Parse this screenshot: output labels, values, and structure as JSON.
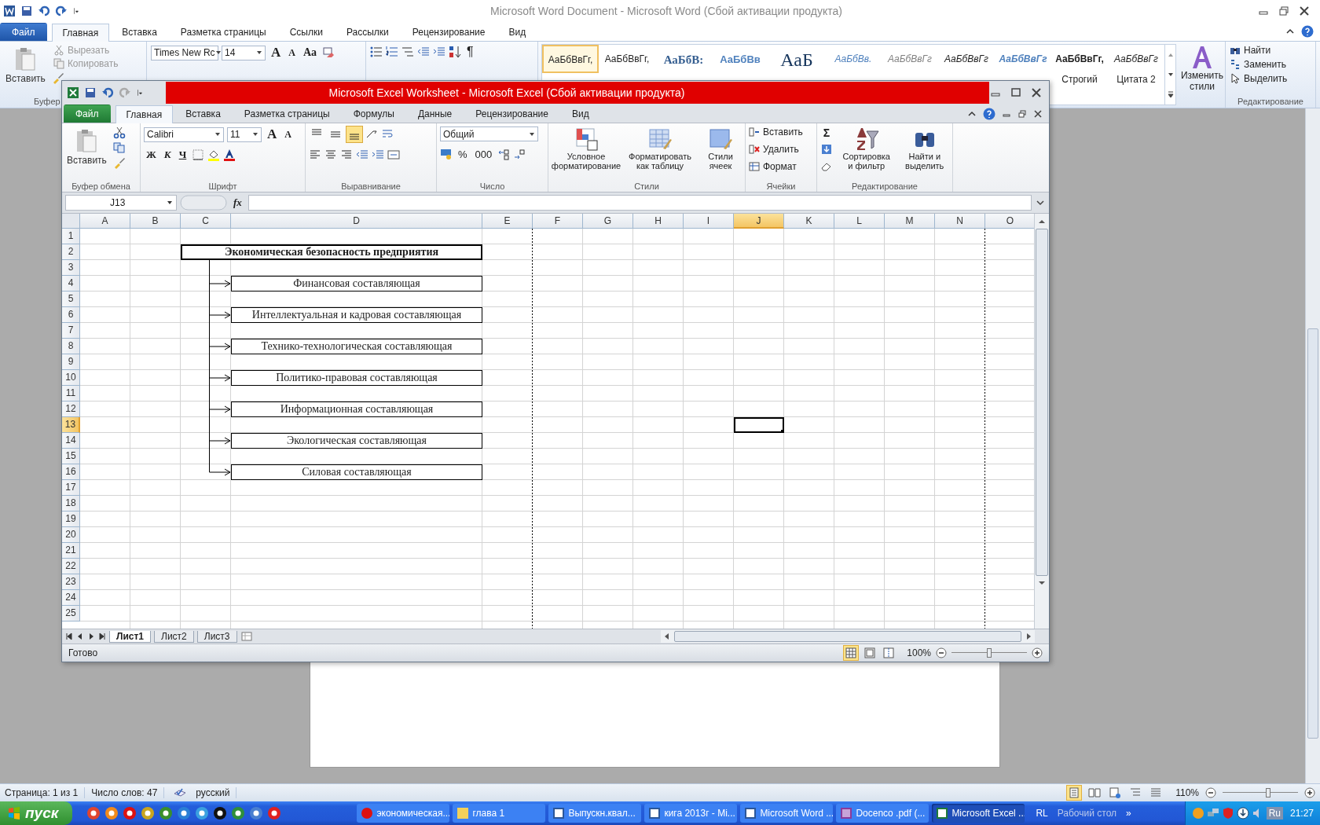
{
  "word": {
    "title": "Microsoft Word Document  -  Microsoft Word (Сбой активации продукта)",
    "tabs": [
      {
        "label": "Файл",
        "kind": "file",
        "selected": false
      },
      {
        "label": "Главная",
        "kind": "tab",
        "selected": true
      },
      {
        "label": "Вставка",
        "kind": "tab",
        "selected": false
      },
      {
        "label": "Разметка страницы",
        "kind": "tab",
        "selected": false
      },
      {
        "label": "Ссылки",
        "kind": "tab",
        "selected": false
      },
      {
        "label": "Рассылки",
        "kind": "tab",
        "selected": false
      },
      {
        "label": "Рецензирование",
        "kind": "tab",
        "selected": false
      },
      {
        "label": "Вид",
        "kind": "tab",
        "selected": false
      }
    ],
    "clipboard": {
      "paste": "Вставить",
      "cut": "Вырезать",
      "copy": "Копировать",
      "disabled": true,
      "group": "Буфер"
    },
    "font": {
      "name": "Times New Rc",
      "size": "14",
      "grow": "A",
      "shrink": "A",
      "change_case": "Aa"
    },
    "pilcrow": "¶",
    "styles": [
      {
        "sample": "АаБбВвГг,",
        "kind": "normal",
        "selected": true
      },
      {
        "sample": "АаБбВвГг,",
        "kind": "normal",
        "selected": false
      },
      {
        "sample": "АаБбВ:",
        "kind": "heading1",
        "selected": false
      },
      {
        "sample": "АаБбВв",
        "kind": "heading2",
        "selected": false
      },
      {
        "sample": "АаБ",
        "kind": "title",
        "selected": false
      },
      {
        "sample": "АаБбВв.",
        "kind": "subtitle",
        "selected": false
      },
      {
        "sample": "АаБбВвГг",
        "kind": "subtle",
        "selected": false
      },
      {
        "sample": "АаБбВвГг",
        "kind": "emphasis",
        "selected": false
      },
      {
        "sample": "АаБбВвГг",
        "kind": "intense",
        "selected": false
      },
      {
        "sample": "АаБбВвГг,",
        "kind": "strong",
        "label": "Строгий",
        "selected": false
      },
      {
        "sample": "АаБбВвГг",
        "kind": "quote",
        "label": "Цитата 2",
        "selected": false
      }
    ],
    "change_styles": "Изменить стили",
    "editing": {
      "find": "Найти",
      "replace": "Заменить",
      "select": "Выделить",
      "group": "Редактирование"
    },
    "status_bar": {
      "page": "Страница: 1 из 1",
      "words": "Число слов: 47",
      "language": "русский",
      "zoom": "110%",
      "zoom_slider": {
        "level": 0.6
      }
    }
  },
  "excel": {
    "title": "Microsoft Excel Worksheet  -  Microsoft Excel (Сбой активации продукта)",
    "tabs": [
      {
        "label": "Файл",
        "kind": "file",
        "selected": false
      },
      {
        "label": "Главная",
        "kind": "tab",
        "selected": true
      },
      {
        "label": "Вставка",
        "kind": "tab",
        "selected": false
      },
      {
        "label": "Разметка страницы",
        "kind": "tab",
        "selected": false
      },
      {
        "label": "Формулы",
        "kind": "tab",
        "selected": false
      },
      {
        "label": "Данные",
        "kind": "tab",
        "selected": false
      },
      {
        "label": "Рецензирование",
        "kind": "tab",
        "selected": false
      },
      {
        "label": "Вид",
        "kind": "tab",
        "selected": false
      }
    ],
    "clipboard": {
      "paste": "Вставить",
      "disabled": true,
      "group": "Буфер обмена"
    },
    "font": {
      "name": "Calibri",
      "size": "11",
      "grow": "A",
      "shrink": "A",
      "bold": "Ж",
      "italic": "К",
      "underline": "Ч",
      "group": "Шрифт"
    },
    "alignment": {
      "vertical": [
        {
          "selected": false
        },
        {
          "selected": false
        },
        {
          "selected": true
        }
      ],
      "group": "Выравнивание"
    },
    "number": {
      "format": "Общий",
      "percent": "%",
      "thousands": "000",
      "group": "Число"
    },
    "styles": {
      "conditional": "Условное форматирование",
      "as_table": "Форматировать как таблицу",
      "cell_styles": "Стили ячеек",
      "group": "Стили"
    },
    "cells": {
      "insert": "Вставить",
      "delete": "Удалить",
      "format": "Формат",
      "group": "Ячейки"
    },
    "editing": {
      "sum": "Σ",
      "sort": "Сортировка и фильтр",
      "find": "Найти и выделить",
      "group": "Редактирование"
    },
    "name_box": "J13",
    "fx": "fx",
    "sheet": {
      "columns": [
        {
          "label": "A",
          "selected": false
        },
        {
          "label": "B",
          "selected": false
        },
        {
          "label": "C",
          "selected": false
        },
        {
          "label": "D",
          "selected": false
        },
        {
          "label": "E",
          "selected": false
        },
        {
          "label": "F",
          "selected": false
        },
        {
          "label": "G",
          "selected": false
        },
        {
          "label": "H",
          "selected": false
        },
        {
          "label": "I",
          "selected": false
        },
        {
          "label": "J",
          "selected": true
        },
        {
          "label": "K",
          "selected": false
        },
        {
          "label": "L",
          "selected": false
        },
        {
          "label": "M",
          "selected": false
        },
        {
          "label": "N",
          "selected": false
        },
        {
          "label": "O",
          "selected": false
        }
      ],
      "rows": [
        {
          "label": "1",
          "selected": false
        },
        {
          "label": "2",
          "selected": false
        },
        {
          "label": "3",
          "selected": false
        },
        {
          "label": "4",
          "selected": false
        },
        {
          "label": "5",
          "selected": false
        },
        {
          "label": "6",
          "selected": false
        },
        {
          "label": "7",
          "selected": false
        },
        {
          "label": "8",
          "selected": false
        },
        {
          "label": "9",
          "selected": false
        },
        {
          "label": "10",
          "selected": false
        },
        {
          "label": "11",
          "selected": false
        },
        {
          "label": "12",
          "selected": false
        },
        {
          "label": "13",
          "selected": true
        },
        {
          "label": "14",
          "selected": false
        },
        {
          "label": "15",
          "selected": false
        },
        {
          "label": "16",
          "selected": false
        },
        {
          "label": "17",
          "selected": false
        },
        {
          "label": "18",
          "selected": false
        },
        {
          "label": "19",
          "selected": false
        },
        {
          "label": "20",
          "selected": false
        },
        {
          "label": "21",
          "selected": false
        },
        {
          "label": "22",
          "selected": false
        },
        {
          "label": "23",
          "selected": false
        },
        {
          "label": "24",
          "selected": false
        },
        {
          "label": "25",
          "selected": false
        }
      ],
      "title": "Экономическая безопасность предприятия",
      "items": [
        "Финансовая составляющая",
        "Интеллектуальная и кадровая составляющая",
        "Технико-технологическая составляющая",
        "Политико-правовая составляющая",
        "Информационная составляющая",
        "Экологическая составляющая",
        "Силовая составляющая"
      ]
    },
    "sheet_tabs": [
      {
        "label": "Лист1",
        "selected": true
      },
      {
        "label": "Лист2",
        "selected": false
      },
      {
        "label": "Лист3",
        "selected": false
      }
    ],
    "status_bar": {
      "ready": "Готово",
      "zoom": "100%",
      "zoom_slider": {
        "level": 0.5
      }
    }
  },
  "taskbar": {
    "start": "пуск",
    "tasks": [
      {
        "label": "экономическая...",
        "kind": "opera",
        "selected": false
      },
      {
        "label": "глава 1",
        "kind": "folder",
        "selected": false
      },
      {
        "label": "Выпускн.квал...",
        "kind": "word",
        "selected": false
      },
      {
        "label": "кига 2013г - Mi...",
        "kind": "word",
        "selected": false
      },
      {
        "label": "Microsoft Word ...",
        "kind": "word",
        "selected": false
      },
      {
        "label": "Docenco .pdf (...",
        "kind": "pdf",
        "selected": false
      },
      {
        "label": "Microsoft Excel ...",
        "kind": "excel",
        "selected": true
      }
    ],
    "language": "RL",
    "desktop": "Рабочий стол",
    "more": "»",
    "tray_language": "Ru",
    "clock": "21:27"
  }
}
